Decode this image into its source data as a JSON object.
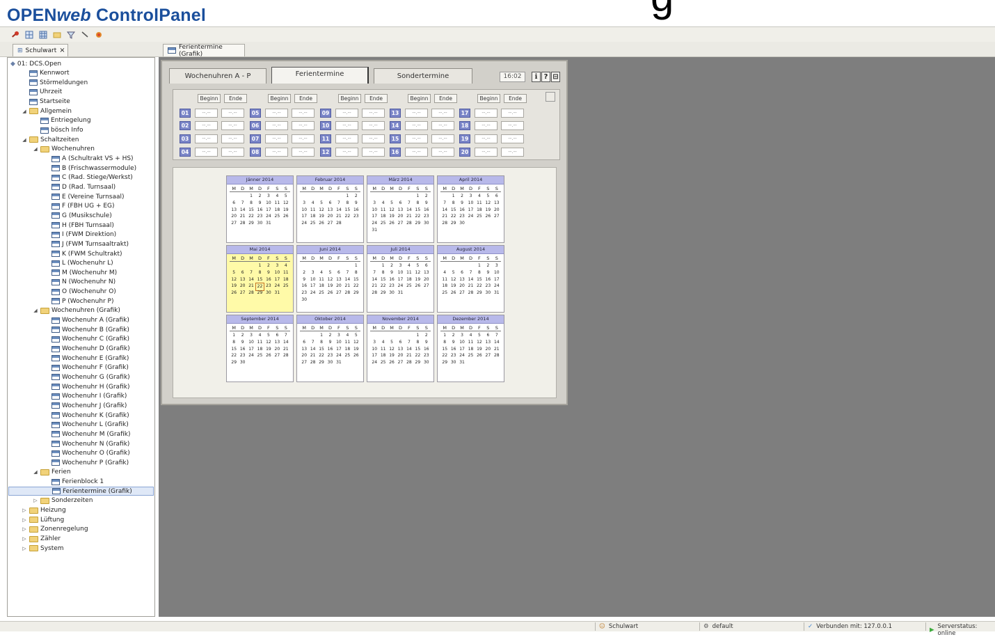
{
  "app_title": {
    "part1": "OPEN",
    "part2": "web",
    "part3": " ControlPanel"
  },
  "deco_glyph": "g",
  "toolbar": {
    "icons": [
      "key-icon",
      "grid-icon",
      "grid2-icon",
      "folder-icon",
      "filter-icon",
      "pointer-icon",
      "paint-icon"
    ]
  },
  "left_tab": {
    "label": "Schulwart",
    "close": "×"
  },
  "doc_tab": {
    "label": "Ferientermine (Grafik)"
  },
  "tree": [
    {
      "label": "01: DCS.Open",
      "level": 0,
      "kind": "root"
    },
    {
      "label": "Kennwort",
      "level": 1,
      "kind": "leaf"
    },
    {
      "label": "Störmeldungen",
      "level": 1,
      "kind": "leaf"
    },
    {
      "label": "Uhrzeit",
      "level": 1,
      "kind": "leaf"
    },
    {
      "label": "Startseite",
      "level": 1,
      "kind": "leaf"
    },
    {
      "label": "Allgemein",
      "level": 1,
      "kind": "open"
    },
    {
      "label": "Entriegelung",
      "level": 2,
      "kind": "leaf"
    },
    {
      "label": "bösch Info",
      "level": 2,
      "kind": "leaf"
    },
    {
      "label": "Schaltzeiten",
      "level": 1,
      "kind": "open"
    },
    {
      "label": "Wochenuhren",
      "level": 2,
      "kind": "open"
    },
    {
      "label": "A (Schultrakt VS + HS)",
      "level": 3,
      "kind": "leaf"
    },
    {
      "label": "B (Frischwassermodule)",
      "level": 3,
      "kind": "leaf"
    },
    {
      "label": "C (Rad. Stiege/Werkst)",
      "level": 3,
      "kind": "leaf"
    },
    {
      "label": "D (Rad. Turnsaal)",
      "level": 3,
      "kind": "leaf"
    },
    {
      "label": "E (Vereine Turnsaal)",
      "level": 3,
      "kind": "leaf"
    },
    {
      "label": "F (FBH UG + EG)",
      "level": 3,
      "kind": "leaf"
    },
    {
      "label": "G (Musikschule)",
      "level": 3,
      "kind": "leaf"
    },
    {
      "label": "H (FBH Turnsaal)",
      "level": 3,
      "kind": "leaf"
    },
    {
      "label": "I (FWM Direktion)",
      "level": 3,
      "kind": "leaf"
    },
    {
      "label": "J (FWM Turnsaaltrakt)",
      "level": 3,
      "kind": "leaf"
    },
    {
      "label": "K (FWM Schultrakt)",
      "level": 3,
      "kind": "leaf"
    },
    {
      "label": "L (Wochenuhr L)",
      "level": 3,
      "kind": "leaf"
    },
    {
      "label": "M (Wochenuhr M)",
      "level": 3,
      "kind": "leaf"
    },
    {
      "label": "N (Wochenuhr N)",
      "level": 3,
      "kind": "leaf"
    },
    {
      "label": "O (Wochenuhr O)",
      "level": 3,
      "kind": "leaf"
    },
    {
      "label": "P (Wochenuhr P)",
      "level": 3,
      "kind": "leaf"
    },
    {
      "label": "Wochenuhren (Grafik)",
      "level": 2,
      "kind": "open"
    },
    {
      "label": "Wochenuhr A  (Grafik)",
      "level": 3,
      "kind": "leaf"
    },
    {
      "label": "Wochenuhr B  (Grafik)",
      "level": 3,
      "kind": "leaf"
    },
    {
      "label": "Wochenuhr C  (Grafik)",
      "level": 3,
      "kind": "leaf"
    },
    {
      "label": "Wochenuhr D  (Grafik)",
      "level": 3,
      "kind": "leaf"
    },
    {
      "label": "Wochenuhr E  (Grafik)",
      "level": 3,
      "kind": "leaf"
    },
    {
      "label": "Wochenuhr F  (Grafik)",
      "level": 3,
      "kind": "leaf"
    },
    {
      "label": "Wochenuhr G  (Grafik)",
      "level": 3,
      "kind": "leaf"
    },
    {
      "label": "Wochenuhr H  (Grafik)",
      "level": 3,
      "kind": "leaf"
    },
    {
      "label": "Wochenuhr I  (Grafik)",
      "level": 3,
      "kind": "leaf"
    },
    {
      "label": "Wochenuhr J  (Grafik)",
      "level": 3,
      "kind": "leaf"
    },
    {
      "label": "Wochenuhr K  (Grafik)",
      "level": 3,
      "kind": "leaf"
    },
    {
      "label": "Wochenuhr L  (Grafik)",
      "level": 3,
      "kind": "leaf"
    },
    {
      "label": "Wochenuhr M  (Grafik)",
      "level": 3,
      "kind": "leaf"
    },
    {
      "label": "Wochenuhr N  (Grafik)",
      "level": 3,
      "kind": "leaf"
    },
    {
      "label": "Wochenuhr O  (Grafik)",
      "level": 3,
      "kind": "leaf"
    },
    {
      "label": "Wochenuhr P  (Grafik)",
      "level": 3,
      "kind": "leaf"
    },
    {
      "label": "Ferien",
      "level": 2,
      "kind": "open"
    },
    {
      "label": "Ferienblock 1",
      "level": 3,
      "kind": "leaf"
    },
    {
      "label": "Ferientermine  (Grafik)",
      "level": 3,
      "kind": "leaf",
      "selected": true
    },
    {
      "label": "Sonderzeiten",
      "level": 2,
      "kind": "closed"
    },
    {
      "label": "Heizung",
      "level": 1,
      "kind": "closed"
    },
    {
      "label": "Lüftung",
      "level": 1,
      "kind": "closed"
    },
    {
      "label": "Zonenregelung",
      "level": 1,
      "kind": "closed"
    },
    {
      "label": "Zähler",
      "level": 1,
      "kind": "closed"
    },
    {
      "label": "System",
      "level": 1,
      "kind": "closed"
    }
  ],
  "calendar": {
    "tabs": [
      "Wochenuhren A - P",
      "Ferientermine",
      "Sondertermine"
    ],
    "active_tab": 1,
    "time": "16:02",
    "top_buttons": [
      "ℹ",
      "?",
      "⊟"
    ],
    "holidays": {
      "begin_label": "Beginn",
      "end_label": "Ende",
      "empty_value": "--.--",
      "slots": [
        "01",
        "02",
        "03",
        "04",
        "05",
        "06",
        "07",
        "08",
        "09",
        "10",
        "11",
        "12",
        "13",
        "14",
        "15",
        "16",
        "17",
        "18",
        "19",
        "20"
      ]
    },
    "weekday_labels": [
      "M",
      "D",
      "M",
      "D",
      "F",
      "S",
      "S"
    ],
    "today": {
      "month": 4,
      "day": 22
    },
    "highlight_month": 4,
    "months": [
      {
        "name": "Jänner 2014",
        "offset": 2,
        "days": 31
      },
      {
        "name": "Februar 2014",
        "offset": 5,
        "days": 28
      },
      {
        "name": "März 2014",
        "offset": 5,
        "days": 31
      },
      {
        "name": "April 2014",
        "offset": 1,
        "days": 30
      },
      {
        "name": "Mai 2014",
        "offset": 3,
        "days": 31
      },
      {
        "name": "Juni 2014",
        "offset": 6,
        "days": 30
      },
      {
        "name": "Juli 2014",
        "offset": 1,
        "days": 31
      },
      {
        "name": "August 2014",
        "offset": 4,
        "days": 31
      },
      {
        "name": "September 2014",
        "offset": 0,
        "days": 30
      },
      {
        "name": "Oktober 2014",
        "offset": 2,
        "days": 31
      },
      {
        "name": "November 2014",
        "offset": 5,
        "days": 30
      },
      {
        "name": "Dezember 2014",
        "offset": 0,
        "days": 31
      }
    ]
  },
  "statusbar": {
    "user": "Schulwart",
    "profile": "default",
    "connection": "Verbunden mit: 127.0.0.1",
    "server": "Serverstatus: online"
  }
}
